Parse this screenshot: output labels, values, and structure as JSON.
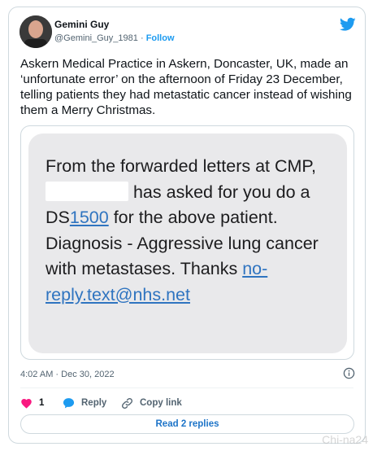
{
  "author": {
    "name": "Gemini Guy",
    "handle": "@Gemini_Guy_1981",
    "separator": "·",
    "follow_label": "Follow"
  },
  "tweet": {
    "text": "Askern Medical Practice in Askern, Doncaster, UK, made an ‘unfortunate error’ on the afternoon of Friday 23 December, telling patients they had metastatic cancer instead of wishing them a Merry Christmas."
  },
  "sms": {
    "part1": "From the forwarded letters at CMP, ",
    "part2": " has asked for you do a DS",
    "form_link": "1500",
    "part3": " for the above patient.  Diagnosis - Aggressive lung cancer with metastases. Thanks ",
    "email_link": "no-reply.text@nhs.net"
  },
  "meta": {
    "timestamp": "4:02 AM · Dec 30, 2022"
  },
  "actions": {
    "like_count": "1",
    "reply_label": "Reply",
    "copy_label": "Copy link",
    "read_replies_label": "Read 2 replies"
  },
  "watermark": "Chi-na24",
  "colors": {
    "twitter_blue": "#1d9bf0",
    "like_red": "#f91880",
    "text_primary": "#0f1419",
    "text_secondary": "#536471",
    "sms_bubble": "#e9e9eb"
  },
  "icons": [
    "twitter-bird-icon",
    "info-icon",
    "heart-icon",
    "reply-bubble-icon",
    "link-icon"
  ]
}
